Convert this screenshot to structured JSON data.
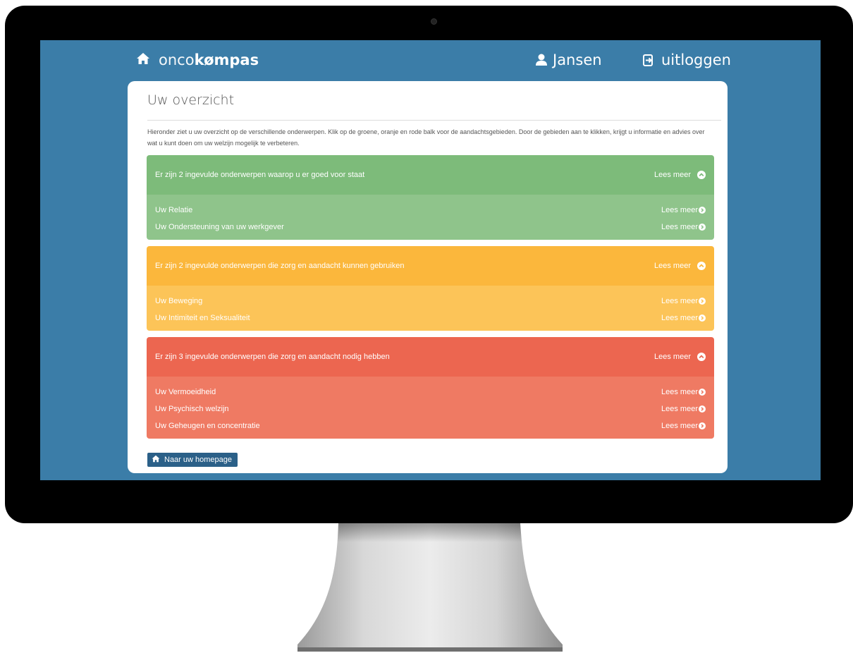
{
  "header": {
    "brand_prefix": "onco",
    "brand_bold": "kømpas",
    "home_icon": "home-icon",
    "user_name": "Jansen",
    "logout_label": "uitloggen"
  },
  "card": {
    "title": "Uw overzicht",
    "intro": "Hieronder ziet u uw overzicht op de verschillende onderwerpen. Klik op de groene, oranje en rode balk voor de aandachtsgebieden. Door de gebieden aan te klikken, krijgt u informatie en advies over wat u kunt doen om uw welzijn mogelijk te verbeteren."
  },
  "sections": [
    {
      "color": "#7dbb7a",
      "heading": "Er zijn 2 ingevulde onderwerpen waarop u er goed voor staat",
      "more_label": "Lees meer",
      "items": [
        {
          "label": "Uw Relatie",
          "more": "Lees meer"
        },
        {
          "label": "Uw Ondersteuning van uw werkgever",
          "more": "Lees meer"
        }
      ]
    },
    {
      "color": "#fbb73c",
      "heading": "Er zijn 2 ingevulde onderwerpen die zorg en aandacht kunnen gebruiken",
      "more_label": "Lees meer",
      "items": [
        {
          "label": "Uw Beweging",
          "more": "Lees meer"
        },
        {
          "label": "Uw Intimiteit en Seksualiteit",
          "more": "Lees meer"
        }
      ]
    },
    {
      "color": "#ec6650",
      "heading": "Er zijn 3 ingevulde onderwerpen die zorg en aandacht nodig hebben",
      "more_label": "Lees meer",
      "items": [
        {
          "label": "Uw Vermoeidheid",
          "more": "Lees meer"
        },
        {
          "label": "Uw Psychisch welzijn",
          "more": "Lees meer"
        },
        {
          "label": "Uw Geheugen en concentratie",
          "more": "Lees meer"
        }
      ]
    }
  ],
  "footer": {
    "home_button_label": "Naar uw homepage"
  }
}
